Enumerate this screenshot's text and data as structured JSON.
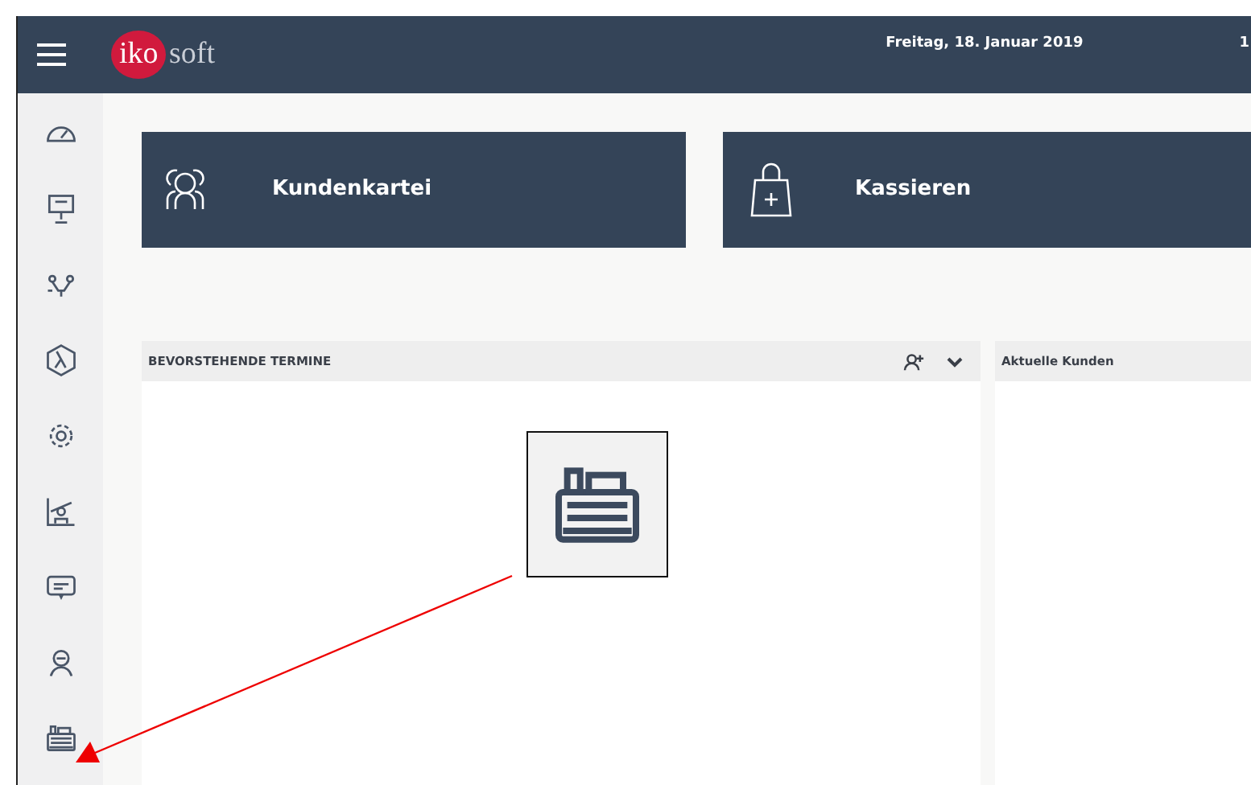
{
  "header": {
    "logo_mark": "iko",
    "logo_text": "soft",
    "date": "Freitag, 18. Januar 2019",
    "time": "1"
  },
  "tiles": [
    {
      "kind": "customers",
      "label": "Kundenkartei"
    },
    {
      "kind": "checkout",
      "label": "Kassieren"
    }
  ],
  "panels": [
    {
      "title": "BEVORSTEHENDE TERMINE",
      "tools": true
    },
    {
      "title": "Aktuelle Kunden",
      "tools": false
    }
  ],
  "annotation": {
    "kind": "callout"
  }
}
